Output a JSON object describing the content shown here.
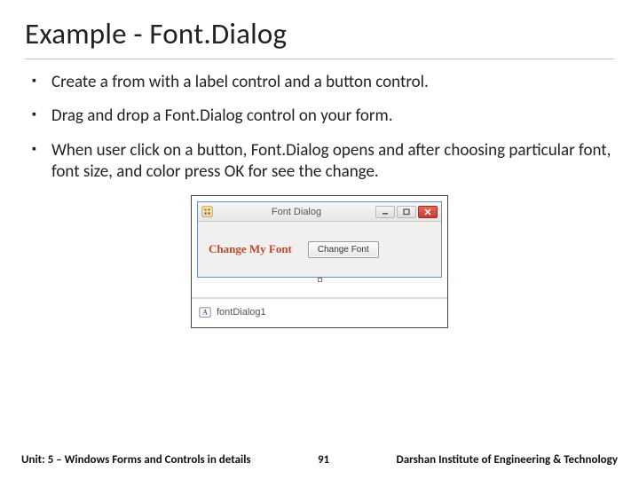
{
  "title": "Example - Font.Dialog",
  "bullets": [
    "Create a from with a label control and a button control.",
    "Drag and drop a Font.Dialog control on your form.",
    "When user click on a button, Font.Dialog opens and after choosing particular font, font size, and color press OK for see the change."
  ],
  "window": {
    "title": "Font Dialog",
    "label_text": "Change My Font",
    "button_text": "Change Font",
    "tray_item": "fontDialog1"
  },
  "footer": {
    "unit": "Unit: 5 – Windows Forms and Controls in details",
    "page": "91",
    "org": "Darshan Institute of Engineering & Technology"
  }
}
